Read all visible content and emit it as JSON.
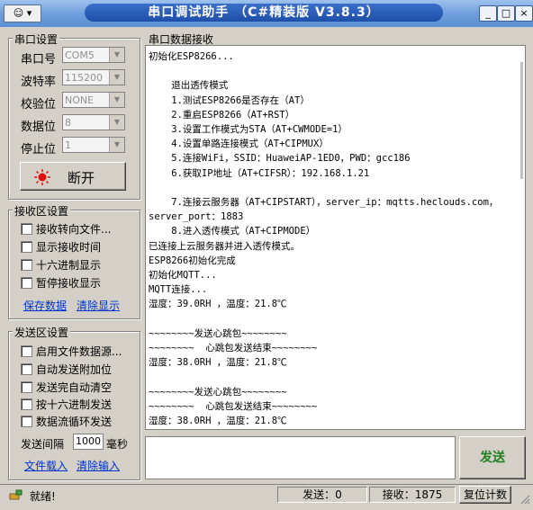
{
  "window": {
    "title": "串口调试助手 （C#精装版 V3.8.3）",
    "sysmenu_label": "☺ ▾",
    "controls": [
      "_",
      "□",
      "×"
    ]
  },
  "serial_settings": {
    "group_label": "串口设置",
    "fields": [
      {
        "label": "串口号",
        "value": "COM5"
      },
      {
        "label": "波特率",
        "value": "115200"
      },
      {
        "label": "校验位",
        "value": "NONE"
      },
      {
        "label": "数据位",
        "value": "8"
      },
      {
        "label": "停止位",
        "value": "1"
      }
    ],
    "toggle_button": "断开"
  },
  "receive_settings": {
    "group_label": "接收区设置",
    "checkboxes": [
      "接收转向文件...",
      "显示接收时间",
      "十六进制显示",
      "暂停接收显示"
    ],
    "links": [
      "保存数据",
      "清除显示"
    ]
  },
  "send_settings": {
    "group_label": "发送区设置",
    "checkboxes": [
      "启用文件数据源...",
      "自动发送附加位",
      "发送完自动清空",
      "按十六进制发送",
      "数据流循环发送"
    ],
    "interval_label": "发送间隔",
    "interval_value": "1000",
    "interval_unit": "毫秒",
    "links": [
      "文件载入",
      "清除输入"
    ]
  },
  "receive_area": {
    "group_label": "串口数据接收",
    "lines": [
      "初始化ESP8266...",
      "",
      "    退出透传模式",
      "    1.测试ESP8266是否存在（AT）",
      "    2.重启ESP8266（AT+RST）",
      "    3.设置工作模式为STA（AT+CWMODE=1）",
      "    4.设置单路连接模式（AT+CIPMUX）",
      "    5.连接WiFi，SSID：HuaweiAP-1ED0，PWD：gcc186",
      "    6.获取IP地址（AT+CIFSR）：192.168.1.21",
      "",
      "    7.连接云服务器（AT+CIPSTART），server_ip：mqtts.heclouds.com，",
      "server_port：1883",
      "    8.进入透传模式（AT+CIPMODE）",
      "已连接上云服务器并进入透传模式。",
      "ESP8266初始化完成",
      "初始化MQTT...",
      "MQTT连接...",
      "湿度：39.0RH ，温度：21.8℃",
      "",
      "~~~~~~~~发送心跳包~~~~~~~~",
      "~~~~~~~~  心跳包发送结束~~~~~~~~",
      "湿度：38.0RH ，温度：21.8℃",
      "",
      "~~~~~~~~发送心跳包~~~~~~~~",
      "~~~~~~~~  心跳包发送结束~~~~~~~~",
      "湿度：38.0RH ，温度：21.8℃"
    ]
  },
  "send_button": "发送",
  "status": {
    "ready_text": "就绪!",
    "sent_label": "发送：0",
    "received_label": "接收：1875",
    "reset_button": "复位计数"
  }
}
